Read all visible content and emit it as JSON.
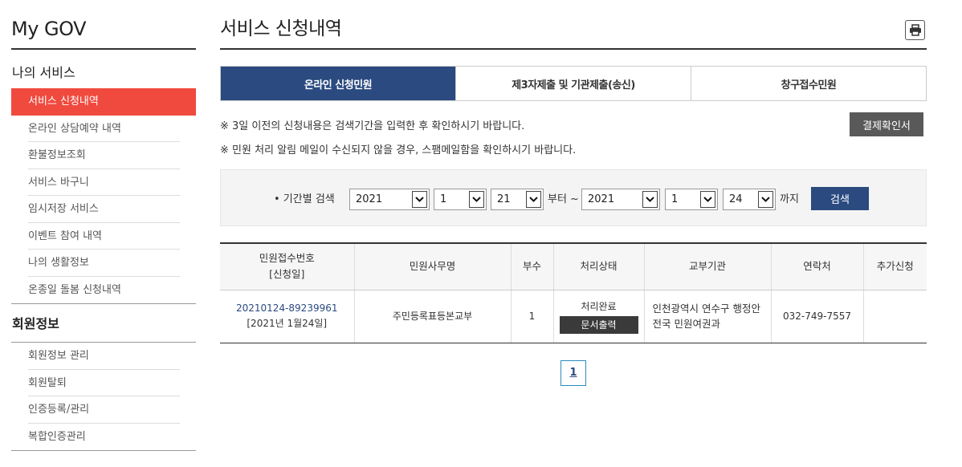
{
  "sidebar": {
    "brand": "My GOV",
    "section1_title": "나의 서비스",
    "items": [
      {
        "label": "서비스 신청내역"
      },
      {
        "label": "온라인 상담예약 내역"
      },
      {
        "label": "환불정보조회"
      },
      {
        "label": "서비스 바구니"
      },
      {
        "label": "임시저장 서비스"
      },
      {
        "label": "이벤트 참여 내역"
      },
      {
        "label": "나의 생활정보"
      },
      {
        "label": "온종일 돌봄 신청내역"
      }
    ],
    "section2_title": "회원정보",
    "items2": [
      {
        "label": "회원정보 관리"
      },
      {
        "label": "회원탈퇴"
      },
      {
        "label": "인증등록/관리"
      },
      {
        "label": "복합인증관리"
      }
    ]
  },
  "main": {
    "title": "서비스 신청내역",
    "tabs": [
      {
        "label": "온라인 신청민원"
      },
      {
        "label": "제3자제출 및 기관제출(송신)"
      },
      {
        "label": "창구접수민원"
      }
    ],
    "notice1": "※ 3일 이전의 신청내용은 검색기간을 입력한 후 확인하시기 바랍니다.",
    "notice2": "※ 민원 처리 알림 메일이 수신되지 않을 경우, 스팸메일함을 확인하시기 바랍니다.",
    "confirm_button": "결제확인서"
  },
  "search": {
    "label": "• 기간별 검색",
    "from_year": "2021",
    "from_month": "1",
    "from_day": "21",
    "from_text": "부터 ~",
    "to_year": "2021",
    "to_month": "1",
    "to_day": "24",
    "to_text": "까지",
    "button": "검색"
  },
  "table": {
    "headers": [
      "민원접수번호",
      "[신청일]",
      "민원사무명",
      "부수",
      "처리상태",
      "교부기관",
      "연락처",
      "추가신청"
    ],
    "rows": [
      {
        "receipt_no": "20210124-89239961",
        "date": "[2021년 1월24일]",
        "service": "주민등록표등본교부",
        "copies": "1",
        "status": "처리완료",
        "status_button": "문서출력",
        "org_line1": "인천광역시 연수구 행정안",
        "org_line2": "전국 민원여권과",
        "phone": "032-749-7557",
        "extra": ""
      }
    ]
  },
  "pager": {
    "current": "1"
  },
  "icons": {
    "print": "printer-icon",
    "dropdown": "chevron-down-icon"
  },
  "colors": {
    "accent_red": "#f04a3e",
    "navy": "#2a4a80",
    "dark_button": "#595959"
  }
}
